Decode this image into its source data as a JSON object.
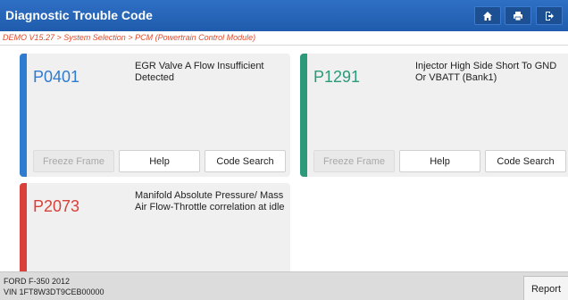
{
  "header": {
    "title": "Diagnostic Trouble Code",
    "icons": [
      "home-icon",
      "print-icon",
      "exit-icon"
    ]
  },
  "breadcrumb": "DEMO V15.27 > System Selection > PCM (Powertrain Control Module)",
  "colors": {
    "header": "#2365b8",
    "breadcrumb_text": "#e04a2a",
    "code_blue": "#2e7bd0",
    "code_green": "#2a9a7a",
    "code_red": "#d9403a"
  },
  "dtc_cards": [
    {
      "code": "P0401",
      "description": "EGR Valve A Flow Insufficient Detected",
      "accent": "#2e7bd0",
      "buttons": {
        "freeze_frame": "Freeze Frame",
        "help": "Help",
        "code_search": "Code Search"
      }
    },
    {
      "code": "P1291",
      "description": "Injector High Side Short To GND Or VBATT (Bank1)",
      "accent": "#2a9a7a",
      "buttons": {
        "freeze_frame": "Freeze Frame",
        "help": "Help",
        "code_search": "Code Search"
      }
    },
    {
      "code": "P2073",
      "description": "Manifold Absolute Pressure/ Mass Air Flow-Throttle correlation at idle",
      "accent": "#d9403a"
    }
  ],
  "footer": {
    "vehicle_model": "FORD F-350 2012",
    "vin": "VIN 1FT8W3DT9CEB00000",
    "report_label": "Report"
  }
}
